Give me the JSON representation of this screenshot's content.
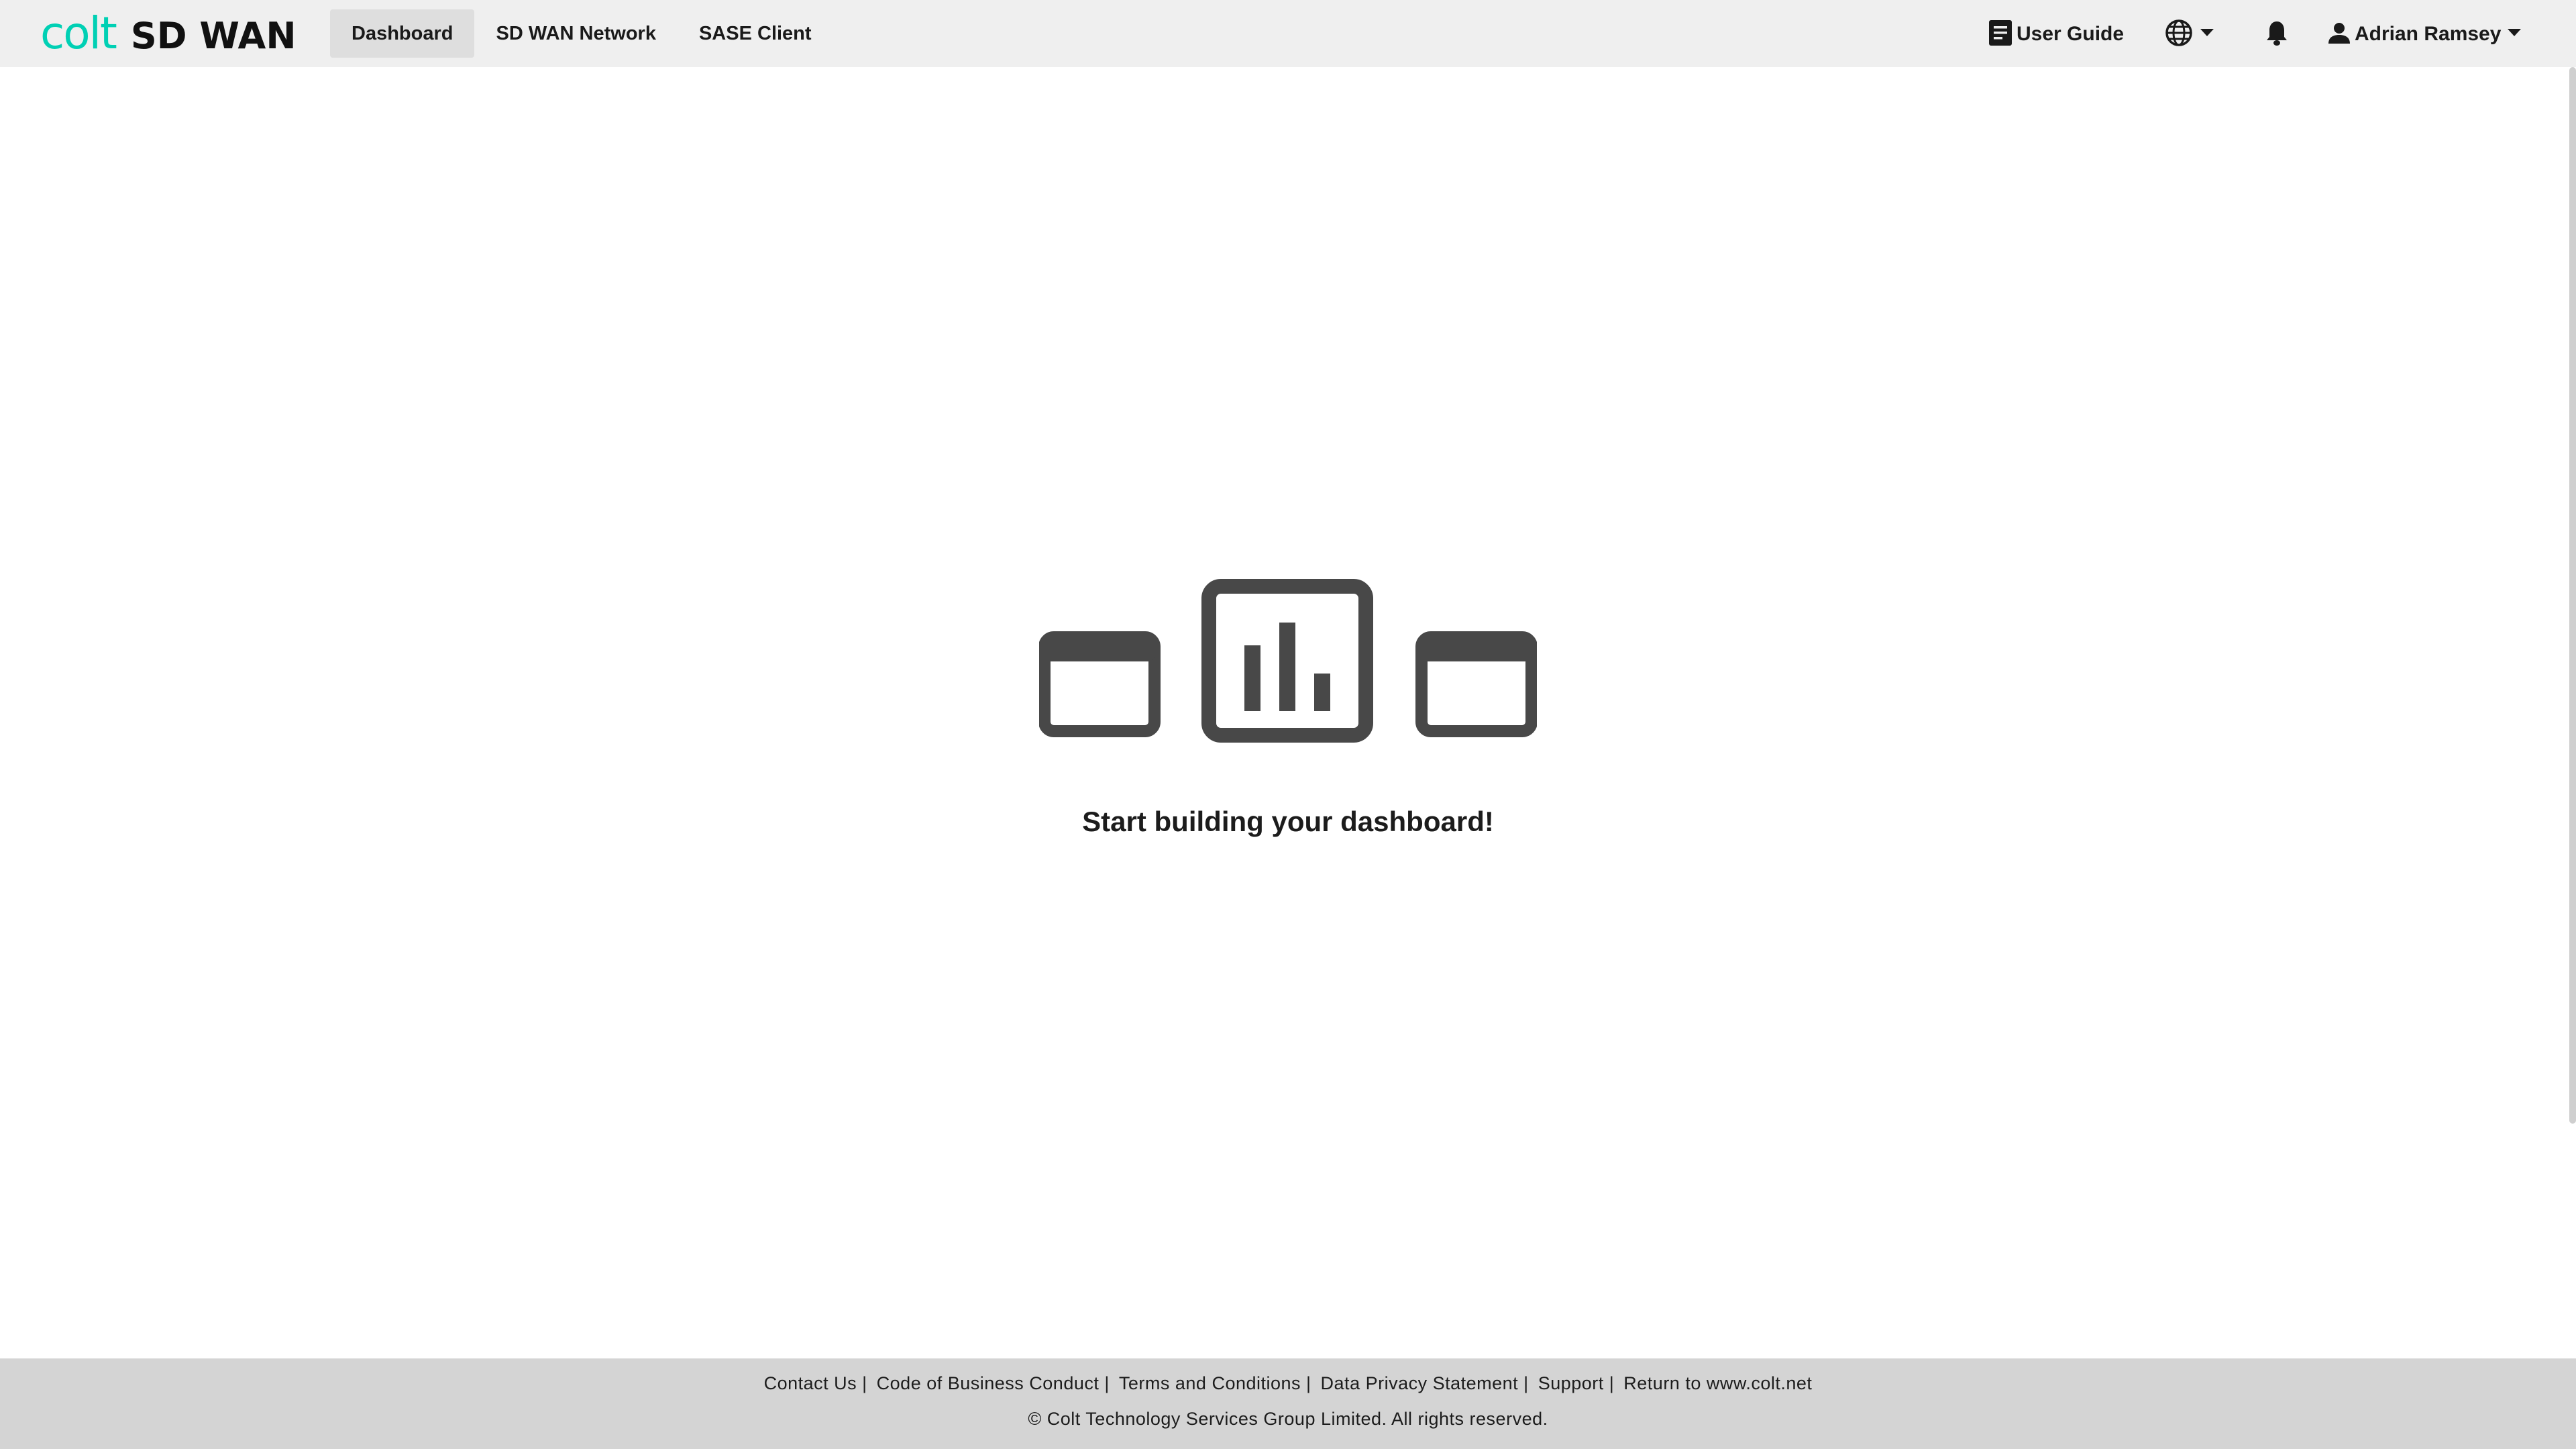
{
  "header": {
    "logo_brand": "colt",
    "logo_product": "SD WAN",
    "tabs": [
      {
        "label": "Dashboard",
        "active": true
      },
      {
        "label": "SD WAN Network",
        "active": false
      },
      {
        "label": "SASE Client",
        "active": false
      }
    ],
    "user_guide_label": "User Guide",
    "user_name": "Adrian Ramsey",
    "icons": {
      "guide": "document-icon",
      "language": "globe-icon",
      "notifications": "bell-icon",
      "user": "person-icon"
    }
  },
  "main": {
    "empty_state_title": "Start building your dashboard!",
    "illustration": "dashboard-widgets-icon"
  },
  "footer": {
    "links": [
      "Contact Us",
      "Code of Business Conduct",
      "Terms and Conditions",
      "Data Privacy Statement",
      "Support",
      "Return to www.colt.net"
    ],
    "copyright": "© Colt Technology Services Group Limited. All rights reserved."
  },
  "colors": {
    "brand_accent": "#00d0b4",
    "topbar_bg": "#efefef",
    "active_tab_bg": "#dedede",
    "footer_bg": "#d4d4d4",
    "illustration": "#484848"
  }
}
